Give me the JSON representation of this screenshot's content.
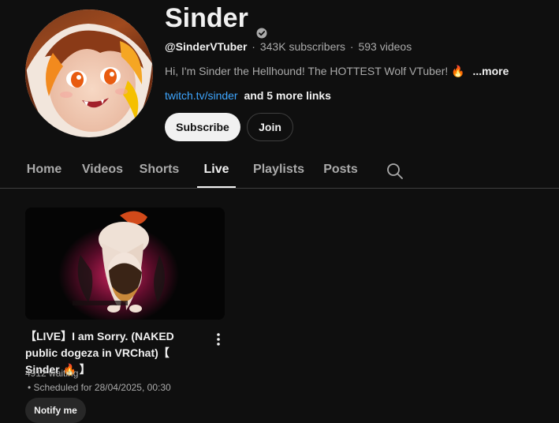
{
  "channel": {
    "name": "Sinder",
    "handle": "@SinderVTuber",
    "subscribers": "343K subscribers",
    "videos": "593 videos",
    "description": "Hi, I'm Sinder the Hellhound! The HOTTEST Wolf VTuber! 🔥",
    "more_label": "...more",
    "link_text": "twitch.tv/sinder",
    "more_links": "and 5 more links",
    "subscribe_label": "Subscribe",
    "join_label": "Join",
    "verified_icon": "verified-check-icon"
  },
  "tabs": [
    {
      "label": "Home"
    },
    {
      "label": "Videos"
    },
    {
      "label": "Shorts"
    },
    {
      "label": "Live",
      "active": true
    },
    {
      "label": "Playlists"
    },
    {
      "label": "Posts"
    }
  ],
  "search_icon": "search-icon",
  "video": {
    "title": "【LIVE】I am Sorry. (NAKED public dogeza in VRChat)【 Sinder 🔥 】",
    "waiting": "4912 waiting",
    "scheduled": "• Scheduled for 28/04/2025, 00:30",
    "notify_label": "Notify me",
    "menu_icon": "more-vert-icon"
  },
  "colors": {
    "background": "#0f0f0f",
    "text": "#f1f1f1",
    "secondary_text": "#aaaaaa",
    "link": "#3ea6ff",
    "button_light": "#f1f1f1",
    "button_dark": "#272727",
    "divider": "#3f3f3f"
  }
}
